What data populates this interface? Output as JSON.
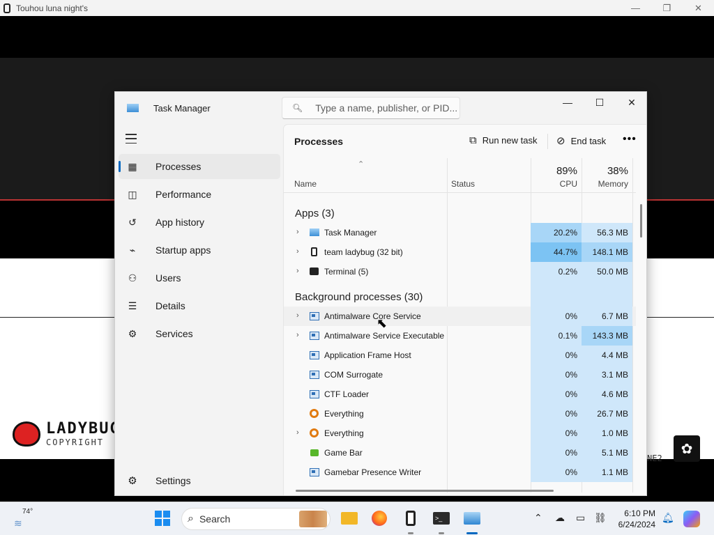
{
  "game_window": {
    "title": "Touhou luna night's",
    "logo_text": "LADYBUG",
    "logo_sub": "COPYRIGHT",
    "right_text": "NE2"
  },
  "task_manager": {
    "title": "Task Manager",
    "search_placeholder": "Type a name, publisher, or PID...",
    "nav": [
      {
        "label": "Processes",
        "icon": "processes-icon",
        "active": true
      },
      {
        "label": "Performance",
        "icon": "performance-icon"
      },
      {
        "label": "App history",
        "icon": "app-history-icon"
      },
      {
        "label": "Startup apps",
        "icon": "startup-apps-icon"
      },
      {
        "label": "Users",
        "icon": "users-icon"
      },
      {
        "label": "Details",
        "icon": "details-icon"
      },
      {
        "label": "Services",
        "icon": "services-icon"
      }
    ],
    "settings_label": "Settings",
    "content_title": "Processes",
    "run_new_task": "Run new task",
    "end_task": "End task",
    "columns": {
      "name": "Name",
      "status": "Status",
      "cpu_pct": "89%",
      "cpu": "CPU",
      "mem_pct": "38%",
      "mem": "Memory"
    },
    "groups": [
      {
        "label": "Apps (3)",
        "rows": [
          {
            "name": "Task Manager",
            "icon": "task-manager-icon",
            "expand": true,
            "cpu": "20.2%",
            "mem": "56.3 MB",
            "cpu_level": 2,
            "mem_level": 1
          },
          {
            "name": "team ladybug (32 bit)",
            "icon": "ladybug-app-icon",
            "expand": true,
            "cpu": "44.7%",
            "mem": "148.1 MB",
            "cpu_level": 3,
            "mem_level": 2
          },
          {
            "name": "Terminal (5)",
            "icon": "terminal-icon",
            "expand": true,
            "cpu": "0.2%",
            "mem": "50.0 MB",
            "cpu_level": 1,
            "mem_level": 1
          }
        ]
      },
      {
        "label": "Background processes (30)",
        "rows": [
          {
            "name": "Antimalware Core Service",
            "icon": "service-icon",
            "expand": true,
            "cpu": "0%",
            "mem": "6.7 MB",
            "cpu_level": 1,
            "mem_level": 1,
            "hover": true
          },
          {
            "name": "Antimalware Service Executable",
            "icon": "service-icon",
            "expand": true,
            "cpu": "0.1%",
            "mem": "143.3 MB",
            "cpu_level": 1,
            "mem_level": 2
          },
          {
            "name": "Application Frame Host",
            "icon": "service-icon",
            "expand": false,
            "cpu": "0%",
            "mem": "4.4 MB",
            "cpu_level": 1,
            "mem_level": 1
          },
          {
            "name": "COM Surrogate",
            "icon": "service-icon",
            "expand": false,
            "cpu": "0%",
            "mem": "3.1 MB",
            "cpu_level": 1,
            "mem_level": 1
          },
          {
            "name": "CTF Loader",
            "icon": "service-icon",
            "expand": false,
            "cpu": "0%",
            "mem": "4.6 MB",
            "cpu_level": 1,
            "mem_level": 1
          },
          {
            "name": "Everything",
            "icon": "everything-icon",
            "expand": false,
            "cpu": "0%",
            "mem": "26.7 MB",
            "cpu_level": 1,
            "mem_level": 1
          },
          {
            "name": "Everything",
            "icon": "everything-icon",
            "expand": true,
            "cpu": "0%",
            "mem": "1.0 MB",
            "cpu_level": 1,
            "mem_level": 1
          },
          {
            "name": "Game Bar",
            "icon": "game-bar-icon",
            "expand": false,
            "cpu": "0%",
            "mem": "5.1 MB",
            "cpu_level": 1,
            "mem_level": 1
          },
          {
            "name": "Gamebar Presence Writer",
            "icon": "service-icon",
            "expand": false,
            "cpu": "0%",
            "mem": "1.1 MB",
            "cpu_level": 1,
            "mem_level": 1
          }
        ]
      }
    ],
    "heat_colors": {
      "1": "#cfe7fa",
      "2": "#a8d6f7",
      "3": "#7cc3f3"
    }
  },
  "taskbar": {
    "temperature": "74°",
    "search_label": "Search",
    "time": "6:10 PM",
    "date": "6/24/2024"
  }
}
